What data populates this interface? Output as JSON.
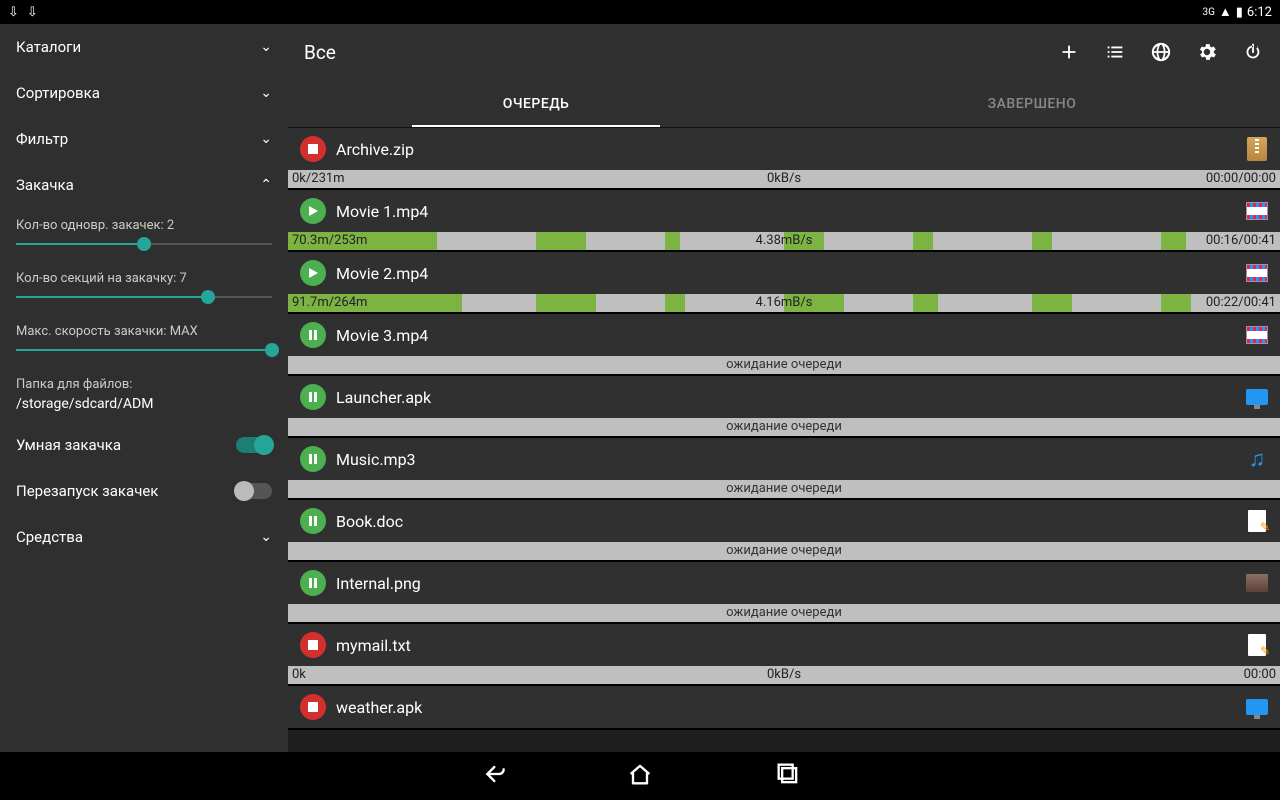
{
  "status": {
    "time": "6:12",
    "network": "3G"
  },
  "sidebar": {
    "items": {
      "catalogs": "Каталоги",
      "sorting": "Сортировка",
      "filter": "Фильтр",
      "download": "Закачка",
      "tools": "Средства"
    },
    "simultaneous": {
      "label": "Кол-во одновр. закачек: 2",
      "percent": 50
    },
    "sections": {
      "label": "Кол-во секций на закачку: 7",
      "percent": 75
    },
    "maxspeed": {
      "label": "Макс. скорость закачки: MAX",
      "percent": 100
    },
    "folder": {
      "label": "Папка для файлов:",
      "path": "/storage/sdcard/ADM"
    },
    "smart": "Умная закачка",
    "restart": "Перезапуск закачек"
  },
  "header": {
    "title": "Все"
  },
  "tabs": {
    "queue": "ОЧЕРЕДЬ",
    "done": "ЗАВЕРШЕНО"
  },
  "waiting_text": "ожидание очереди",
  "downloads": [
    {
      "name": "Archive.zip",
      "btn": "stop",
      "type": "zip",
      "left": "0k/231m",
      "center": "0kB/s",
      "right": "00:00/00:00",
      "segments": []
    },
    {
      "name": "Movie 1.mp4",
      "btn": "play",
      "type": "video",
      "left": "70.3m/253m",
      "center": "4.38mB/s",
      "right": "00:16/00:41",
      "segments": [
        [
          0,
          15
        ],
        [
          25,
          30
        ],
        [
          38,
          39.5
        ],
        [
          50,
          54
        ],
        [
          63,
          65
        ],
        [
          75,
          77
        ],
        [
          88,
          90.5
        ]
      ]
    },
    {
      "name": "Movie 2.mp4",
      "btn": "play",
      "type": "video",
      "left": "91.7m/264m",
      "center": "4.16mB/s",
      "right": "00:22/00:41",
      "segments": [
        [
          0,
          17.5
        ],
        [
          25,
          31
        ],
        [
          38,
          40
        ],
        [
          50,
          56
        ],
        [
          63,
          65.5
        ],
        [
          75,
          79
        ],
        [
          88,
          91
        ]
      ]
    },
    {
      "name": "Movie 3.mp4",
      "btn": "pause",
      "type": "video",
      "waiting": true
    },
    {
      "name": "Launcher.apk",
      "btn": "pause",
      "type": "app",
      "waiting": true
    },
    {
      "name": "Music.mp3",
      "btn": "pause",
      "type": "music",
      "waiting": true
    },
    {
      "name": "Book.doc",
      "btn": "pause",
      "type": "doc",
      "waiting": true
    },
    {
      "name": "Internal.png",
      "btn": "pause",
      "type": "image",
      "waiting": true
    },
    {
      "name": "mymail.txt",
      "btn": "stop",
      "type": "doc",
      "left": "0k",
      "center": "0kB/s",
      "right": "00:00",
      "segments": []
    },
    {
      "name": "weather.apk",
      "btn": "stop",
      "type": "app",
      "partial": true
    }
  ]
}
